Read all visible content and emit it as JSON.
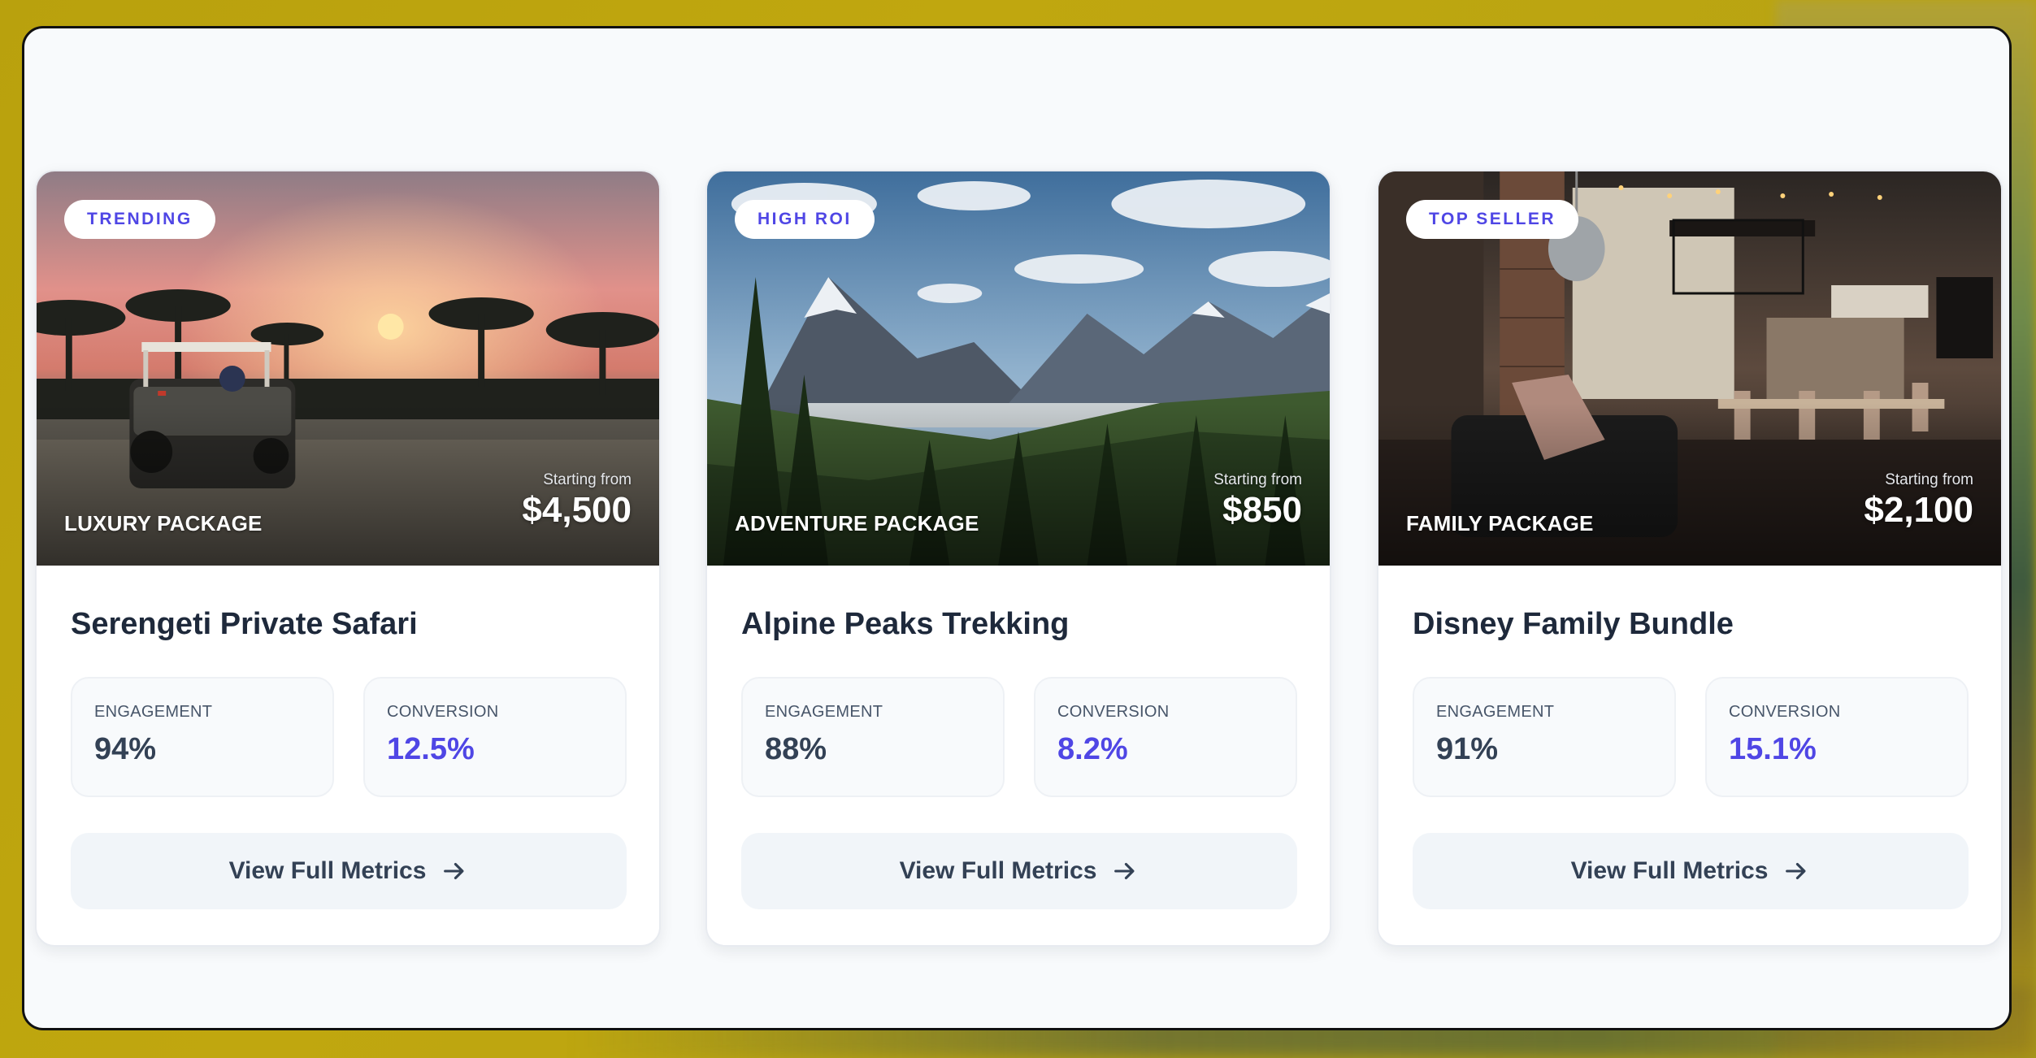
{
  "theme": {
    "accent": "#4f46e5",
    "text": "#1e293b",
    "button_bg": "#f1f5f9"
  },
  "cards": [
    {
      "badge": "TRENDING",
      "package_label": "LUXURY PACKAGE",
      "price_prefix": "Starting from",
      "price": "$4,500",
      "title": "Serengeti Private Safari",
      "metrics": [
        {
          "label": "ENGAGEMENT",
          "value": "94%"
        },
        {
          "label": "CONVERSION",
          "value": "12.5%"
        }
      ],
      "button_label": "View Full Metrics",
      "button_icon": "arrow-right-icon"
    },
    {
      "badge": "HIGH ROI",
      "package_label": "ADVENTURE PACKAGE",
      "price_prefix": "Starting from",
      "price": "$850",
      "title": "Alpine Peaks Trekking",
      "metrics": [
        {
          "label": "ENGAGEMENT",
          "value": "88%"
        },
        {
          "label": "CONVERSION",
          "value": "8.2%"
        }
      ],
      "button_label": "View Full Metrics",
      "button_icon": "arrow-right-icon"
    },
    {
      "badge": "TOP SELLER",
      "package_label": "FAMILY PACKAGE",
      "price_prefix": "Starting from",
      "price": "$2,100",
      "title": "Disney Family Bundle",
      "metrics": [
        {
          "label": "ENGAGEMENT",
          "value": "91%"
        },
        {
          "label": "CONVERSION",
          "value": "15.1%"
        }
      ],
      "button_label": "View Full Metrics",
      "button_icon": "arrow-right-icon"
    }
  ]
}
